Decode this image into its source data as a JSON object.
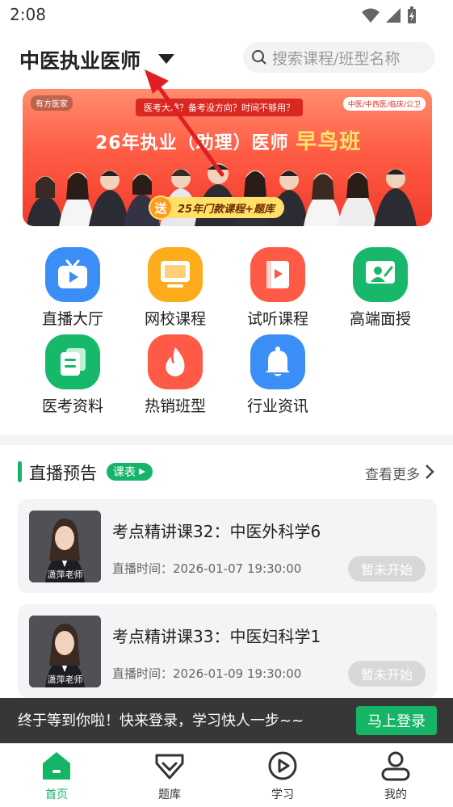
{
  "status_bar": {
    "time": "2:08"
  },
  "header": {
    "title": "中医执业医师",
    "search_placeholder": "搜索课程/班型名称"
  },
  "banner": {
    "brand": "有方医家",
    "question": "医考大难？备考没方向？时间不够用？",
    "tags": "中医/中西医/临床/公卫",
    "headline": "26年执业（助理）医师",
    "headline_highlight": "早鸟班",
    "gift_badge": "送",
    "gift_text": "25年门款课程+题库"
  },
  "grid": [
    {
      "label": "直播大厅",
      "icon": "tv-icon",
      "color": "#3a8ef6"
    },
    {
      "label": "网校课程",
      "icon": "monitor-icon",
      "color": "#ffac1c"
    },
    {
      "label": "试听课程",
      "icon": "book-icon",
      "color": "#ff5a45"
    },
    {
      "label": "高端面授",
      "icon": "teacher-icon",
      "color": "#18b86a"
    },
    {
      "label": "医考资料",
      "icon": "documents-icon",
      "color": "#18b86a"
    },
    {
      "label": "热销班型",
      "icon": "flame-icon",
      "color": "#ff5a45"
    },
    {
      "label": "行业资讯",
      "icon": "bell-icon",
      "color": "#3a8ef6"
    }
  ],
  "live_section": {
    "title": "直播预告",
    "tag": "课表",
    "more": "查看更多",
    "items": [
      {
        "title": "考点精讲课32：中医外科学6",
        "time": "直播时间：2026-01-07 19:30:00",
        "status": "暂未开始",
        "teacher": "潇萍老师"
      },
      {
        "title": "考点精讲课33：中医妇科学1",
        "time": "直播时间：2026-01-09 19:30:00",
        "status": "暂未开始",
        "teacher": "潇萍老师"
      }
    ]
  },
  "login_prompt": {
    "message": "终于等到你啦！快来登录，学习快人一步~~",
    "button": "马上登录"
  },
  "tabs": [
    {
      "label": "首页",
      "active": true
    },
    {
      "label": "题库",
      "active": false
    },
    {
      "label": "学习",
      "active": false
    },
    {
      "label": "我的",
      "active": false
    }
  ],
  "colors": {
    "accent": "#16b466",
    "banner_red": "#f23a2c"
  }
}
